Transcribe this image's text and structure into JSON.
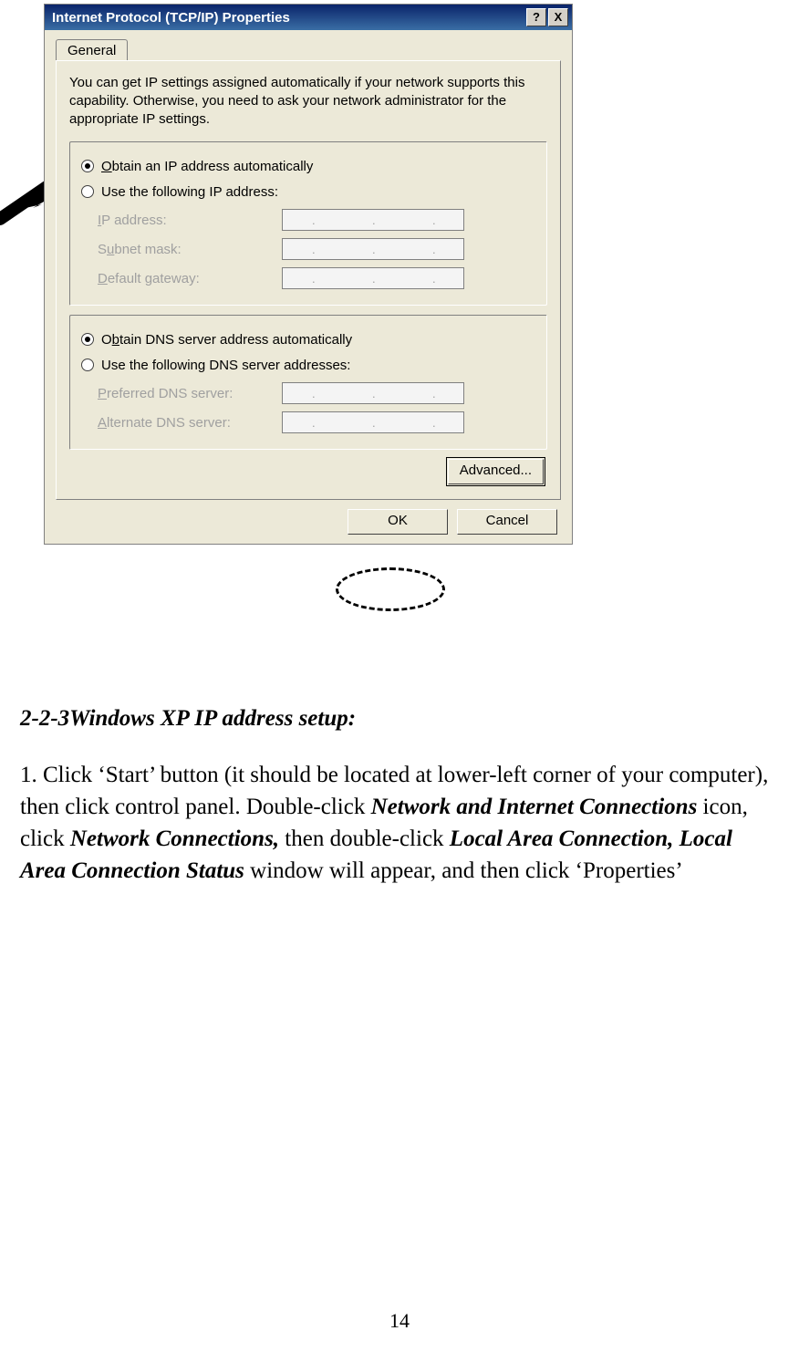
{
  "dialog": {
    "title": "Internet Protocol (TCP/IP) Properties",
    "help_symbol": "?",
    "close_symbol": "X",
    "tab_label": "General",
    "description": "You can get IP settings assigned automatically if your network supports this capability. Otherwise, you need to ask your network administrator for the appropriate IP settings.",
    "ip_group": {
      "auto_label": "Obtain an IP address automatically",
      "manual_label": "Use the following IP address:",
      "ip_label": "IP address:",
      "subnet_label": "Subnet mask:",
      "gateway_label": "Default gateway:"
    },
    "dns_group": {
      "auto_label": "Obtain DNS server address automatically",
      "manual_label": "Use the following DNS server addresses:",
      "preferred_label": "Preferred DNS server:",
      "alternate_label": "Alternate DNS server:"
    },
    "advanced_label": "Advanced...",
    "ok_label": "OK",
    "cancel_label": "Cancel"
  },
  "document": {
    "heading": "2-2-3Windows XP IP address setup:",
    "para_parts": {
      "p1": "1. Click ‘Start’ button (it should be located at lower-left corner of your computer), then click control panel. Double-click ",
      "b1": "Network and Internet Connections",
      "p2": " icon, click ",
      "b2": "Network Connections,",
      "p3": " then double-click ",
      "b3": "Local Area Connection, Local Area Connection Status",
      "p4": " window will appear, and then click ‘Properties’"
    },
    "page_number": "14"
  }
}
